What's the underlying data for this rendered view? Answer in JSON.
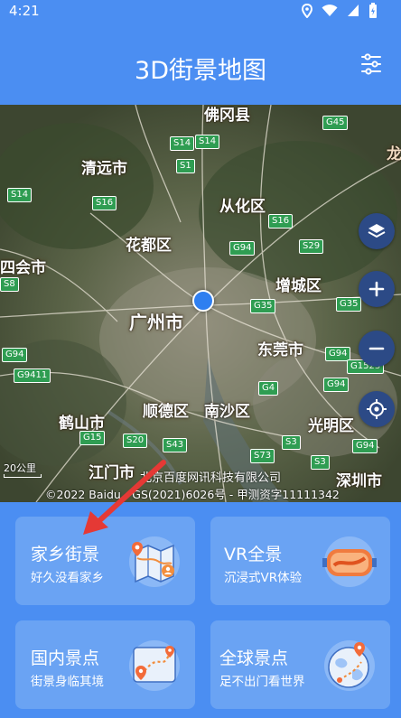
{
  "status_bar": {
    "time": "4:21"
  },
  "app_bar": {
    "title": "3D街景地图"
  },
  "map": {
    "cities": [
      {
        "id": "qingyuan",
        "label": "清远市"
      },
      {
        "id": "conghua",
        "label": "从化区"
      },
      {
        "id": "huadu",
        "label": "花都区"
      },
      {
        "id": "sihui",
        "label": "四会市"
      },
      {
        "id": "guangzhou",
        "label": "广州市"
      },
      {
        "id": "zengcheng",
        "label": "增城区"
      },
      {
        "id": "dongguan",
        "label": "东莞市"
      },
      {
        "id": "shunde",
        "label": "顺德区"
      },
      {
        "id": "nansha",
        "label": "南沙区"
      },
      {
        "id": "heshan",
        "label": "鹤山市"
      },
      {
        "id": "guangming",
        "label": "光明区"
      },
      {
        "id": "jiangmen",
        "label": "江门市"
      },
      {
        "id": "shenzhen",
        "label": "深圳市"
      },
      {
        "id": "fogang",
        "label": "佛冈县"
      },
      {
        "id": "long",
        "label": "龙"
      }
    ],
    "highways": [
      "S14",
      "S14",
      "S1",
      "S16",
      "S16",
      "G45",
      "S14",
      "G94",
      "S29",
      "S8",
      "G35",
      "G35",
      "G94",
      "G9411",
      "G94",
      "G4",
      "G1523",
      "S3",
      "S20",
      "G15",
      "S43",
      "S73",
      "S3",
      "G94",
      "G94"
    ],
    "scale": "20公里",
    "company": "北京百度网讯科技有限公司",
    "copyright": "©2022 Baidu - GS(2021)6026号 - 甲测资字11111342"
  },
  "cards": [
    {
      "title": "家乡街景",
      "subtitle": "好久没看家乡"
    },
    {
      "title": "VR全景",
      "subtitle": "沉浸式VR体验"
    },
    {
      "title": "国内景点",
      "subtitle": "街景身临其境"
    },
    {
      "title": "全球景点",
      "subtitle": "足不出门看世界"
    }
  ],
  "colors": {
    "primary": "#4b8ef2",
    "card": "#6aa3f3",
    "control": "#2c4a86",
    "location": "#2f7ff0",
    "arrow": "#e53935"
  },
  "icons": [
    "location-icon",
    "wifi-icon",
    "signal-icon",
    "battery-icon",
    "filter-icon",
    "layers-icon",
    "zoom-in-icon",
    "zoom-out-icon",
    "locate-icon"
  ]
}
